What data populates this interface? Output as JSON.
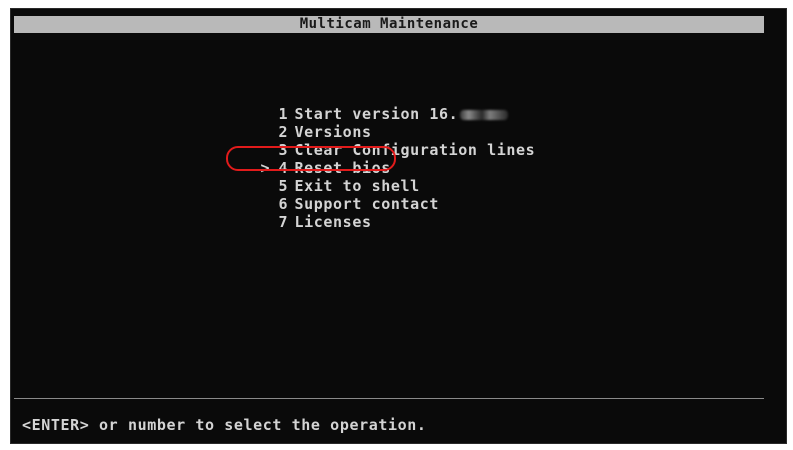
{
  "window": {
    "title": "Multicam Maintenance"
  },
  "menu": {
    "selected_marker": ">",
    "items": [
      {
        "number": "1",
        "label": "Start version 16.",
        "selected": false,
        "value_obscured": true
      },
      {
        "number": "2",
        "label": "Versions",
        "selected": false
      },
      {
        "number": "3",
        "label": "Clear Configuration lines",
        "selected": false
      },
      {
        "number": "4",
        "label": "Reset bios",
        "selected": true
      },
      {
        "number": "5",
        "label": "Exit to shell",
        "selected": false
      },
      {
        "number": "6",
        "label": "Support contact",
        "selected": false
      },
      {
        "number": "7",
        "label": "Licenses",
        "selected": false
      }
    ]
  },
  "status": {
    "hint": "<ENTER> or number to select the operation."
  },
  "colors": {
    "terminal_bg": "#0a0a0a",
    "text": "#d4d4d4",
    "title_bar": "#b9b9b9",
    "highlight_annotation": "#e21b1b"
  }
}
